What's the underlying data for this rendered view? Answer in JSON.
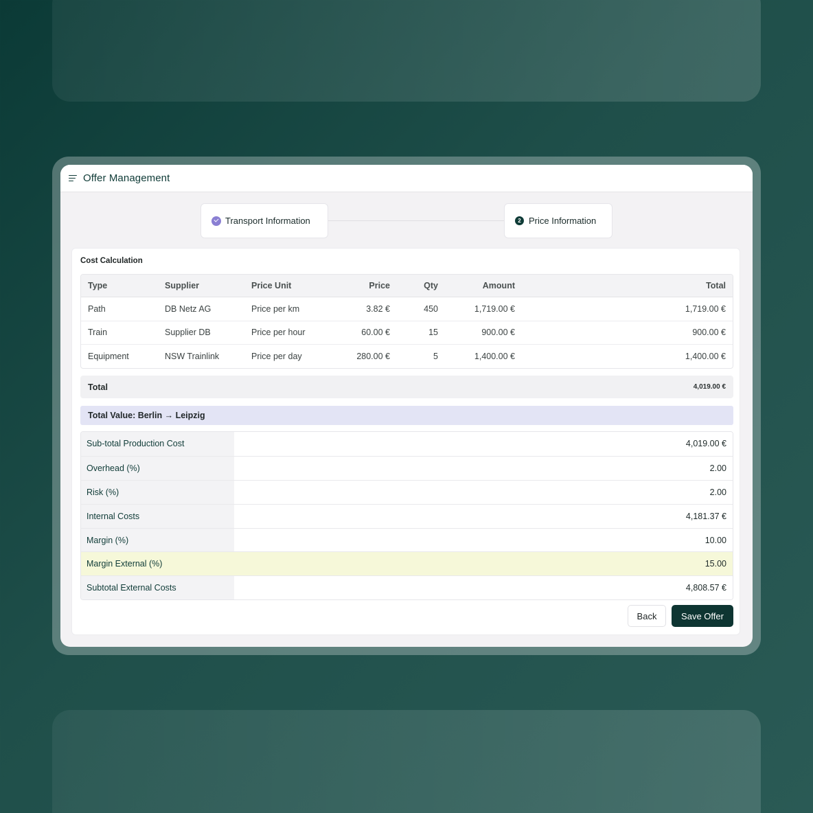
{
  "app": {
    "title": "Offer Management"
  },
  "steps": [
    {
      "label": "Transport Information",
      "status": "completed"
    },
    {
      "label": "Price Information",
      "number": "2",
      "status": "active"
    }
  ],
  "cost_calculation": {
    "title": "Cost Calculation",
    "columns": [
      "Type",
      "Supplier",
      "Price Unit",
      "Price",
      "Qty",
      "Amount",
      "Total"
    ],
    "rows": [
      {
        "type": "Path",
        "supplier": "DB Netz AG",
        "unit": "Price per km",
        "price": "3.82 €",
        "qty": "450",
        "amount": "1,719.00 €",
        "total": "1,719.00 €"
      },
      {
        "type": "Train",
        "supplier": "Supplier DB",
        "unit": "Price per hour",
        "price": "60.00 €",
        "qty": "15",
        "amount": "900.00 €",
        "total": "900.00 €"
      },
      {
        "type": "Equipment",
        "supplier": "NSW Trainlink",
        "unit": "Price per day",
        "price": "280.00 €",
        "qty": "5",
        "amount": "1,400.00 €",
        "total": "1,400.00 €"
      }
    ],
    "total_label": "Total",
    "total_value": "4,019.00 €"
  },
  "route": {
    "label": "Total Value: Berlin → Leipzig"
  },
  "summary": [
    {
      "label": "Sub-total Production Cost",
      "value": "4,019.00 €"
    },
    {
      "label": "Overhead (%)",
      "value": "2.00"
    },
    {
      "label": "Risk (%)",
      "value": "2.00"
    },
    {
      "label": "Internal Costs",
      "value": "4,181.37 €"
    },
    {
      "label": "Margin (%)",
      "value": "10.00"
    },
    {
      "label": "Margin External (%)",
      "value": "15.00",
      "highlighted": true
    },
    {
      "label": "Subtotal External Costs",
      "value": "4,808.57 €"
    }
  ],
  "actions": {
    "back_label": "Back",
    "save_label": "Save Offer"
  },
  "colors": {
    "primary": "#0e3532",
    "step_check": "#8a7fd3",
    "route_bg": "#e3e4f5",
    "highlight_bg": "#f6f8d9"
  }
}
